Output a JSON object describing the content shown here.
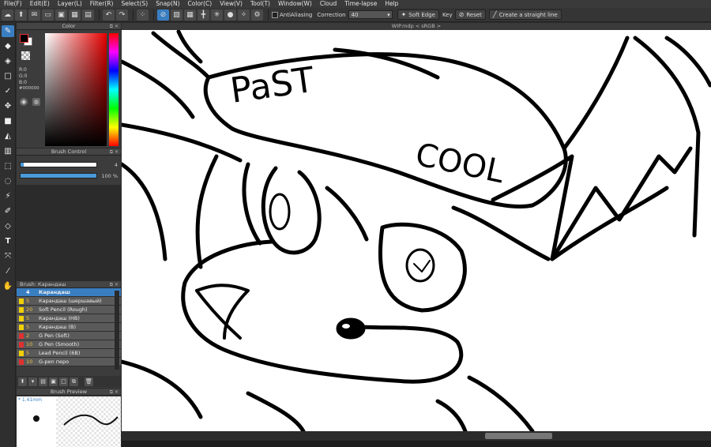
{
  "menu": [
    "File(F)",
    "Edit(E)",
    "Layer(L)",
    "Filter(R)",
    "Select(S)",
    "Snap(N)",
    "Color(C)",
    "View(V)",
    "Tool(T)",
    "Window(W)",
    "Cloud",
    "Time-lapse",
    "Help"
  ],
  "toolbar": {
    "antialiasing_label": "AntiAliasing",
    "correction_label": "Correction",
    "correction_value": "40",
    "soft_edge_label": "Soft Edge",
    "key_label": "Key",
    "reset_label": "Reset",
    "straight_line_label": "Create a straight line"
  },
  "color_panel": {
    "title": "Color",
    "r": "R:0",
    "g": "G:0",
    "b": "B:0",
    "hex": "#000000",
    "fg_color": "#000000",
    "hue_color": "#e60000"
  },
  "brush_control": {
    "title": "Brush Control",
    "size_value": "4",
    "opacity_value": "100 %",
    "size_fraction": 0.04,
    "opacity_fraction": 1.0
  },
  "brush_list": {
    "title": "Brush: Карандаш",
    "items": [
      {
        "size": "4",
        "name": "Карандаш",
        "color": "#3a7ec2",
        "selected": true
      },
      {
        "size": "5",
        "name": "Карандаш (шершавый)",
        "color": "#f0d000",
        "selected": false
      },
      {
        "size": "20",
        "name": "Soft Pencil (Rough)",
        "color": "#f0d000",
        "selected": false
      },
      {
        "size": "5",
        "name": "Карандаш (HB)",
        "color": "#f0d000",
        "selected": false
      },
      {
        "size": "5",
        "name": "Карандаш (B)",
        "color": "#f0d000",
        "selected": false
      },
      {
        "size": "2",
        "name": "G Pen (Soft)",
        "color": "#e03030",
        "selected": false
      },
      {
        "size": "10",
        "name": "G Pen (Smooth)",
        "color": "#e03030",
        "selected": false
      },
      {
        "size": "5",
        "name": "Lead Pencil (6B)",
        "color": "#f0d000",
        "selected": false
      },
      {
        "size": "10",
        "name": "G-pen перо",
        "color": "#e03030",
        "selected": false
      }
    ]
  },
  "brush_preview": {
    "title": "Brush Preview",
    "size_label": "* 1.41mm"
  },
  "canvas": {
    "tab_title": "WIP.mdp < sRGB >",
    "text_past": "PaST",
    "text_cool": "COOL"
  },
  "icons": {
    "tools": [
      "brush-icon",
      "eraser-icon",
      "fill-eraser-icon",
      "rect-icon",
      "pen-check-icon",
      "move-icon",
      "rect-fill-icon",
      "bucket-icon",
      "gradient-icon",
      "select-rect-icon",
      "lasso-icon",
      "magic-wand-icon",
      "select-pen-icon",
      "select-eraser-icon",
      "text-icon",
      "transform-icon",
      "eyedropper-icon",
      "hand-icon"
    ]
  }
}
